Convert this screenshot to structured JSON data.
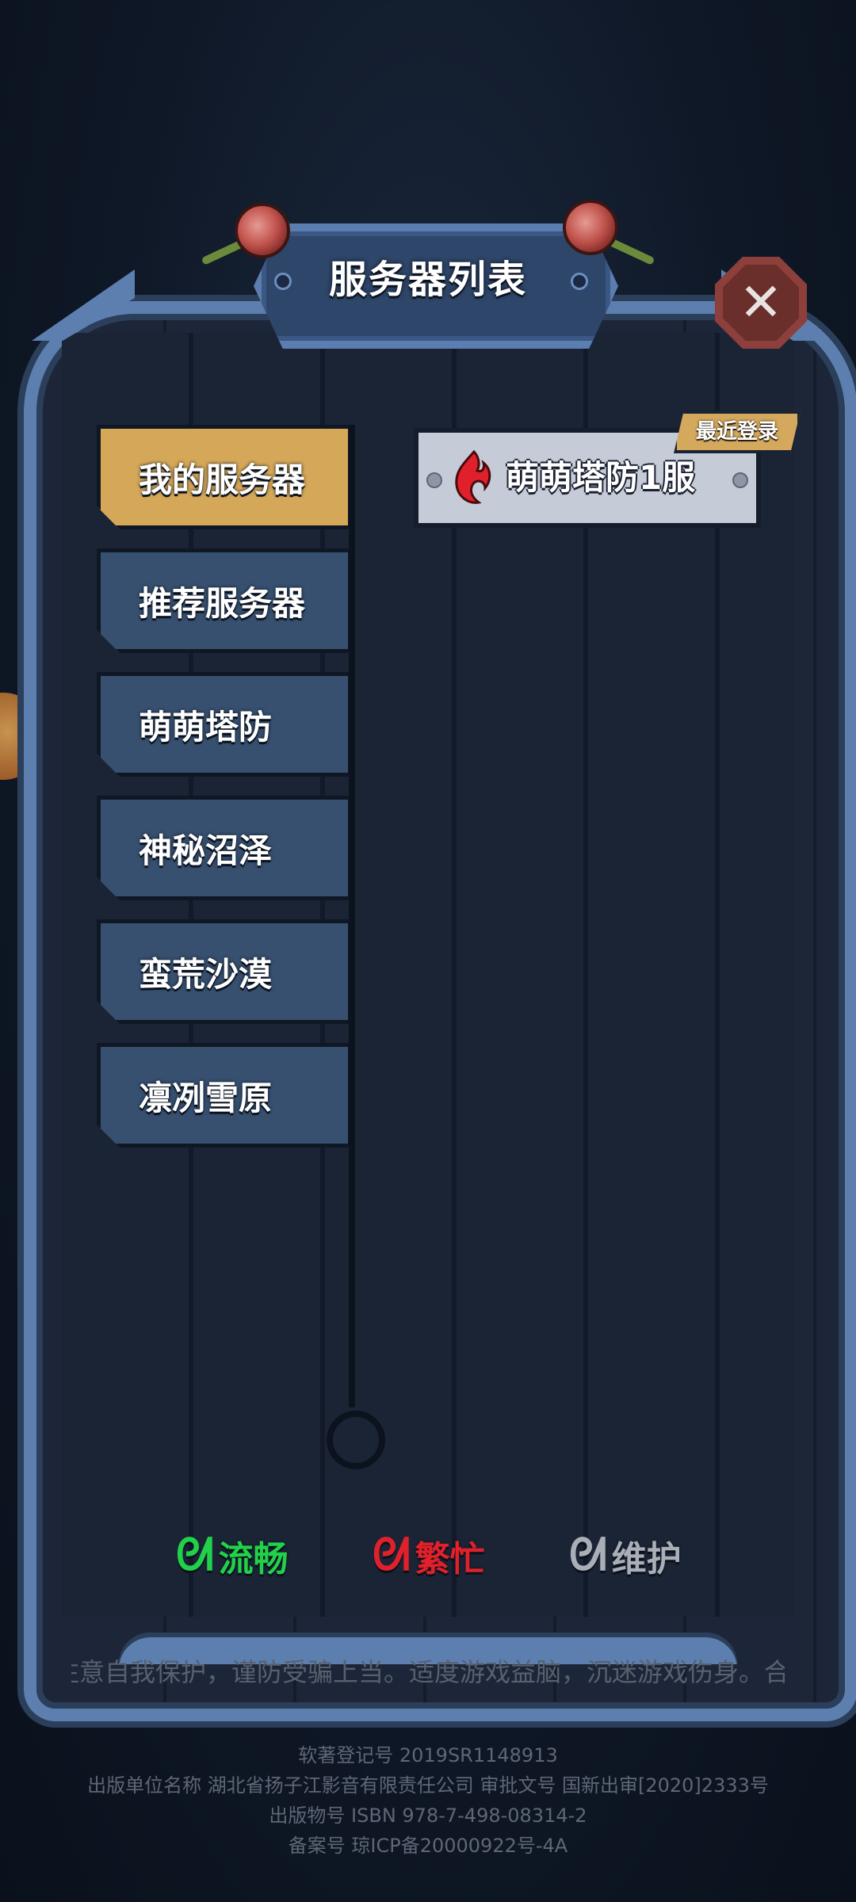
{
  "dialog": {
    "title": "服务器列表",
    "close_icon": "close-icon"
  },
  "menu": {
    "items": [
      {
        "label": "我的服务器",
        "active": true
      },
      {
        "label": "推荐服务器",
        "active": false
      },
      {
        "label": "萌萌塔防",
        "active": false
      },
      {
        "label": "神秘沼泽",
        "active": false
      },
      {
        "label": "蛮荒沙漠",
        "active": false
      },
      {
        "label": "凛冽雪原",
        "active": false
      }
    ]
  },
  "servers": {
    "recent_badge": "最近登录",
    "items": [
      {
        "name": "萌萌塔防1服",
        "status": "busy",
        "status_icon": "flame-status-icon"
      }
    ]
  },
  "legend": {
    "smooth": {
      "label": "流畅",
      "color": "#22d14a"
    },
    "busy": {
      "label": "繁忙",
      "color": "#e0212b"
    },
    "maintenance": {
      "label": "维护",
      "color": "#a9aeb7"
    }
  },
  "notice": {
    "health_text": "抵制不良游戏，拒绝盗版游戏。注意自我保护，谨防受骗上当。适度游戏益脑，沉迷游戏伤身。合理安排时间，享受健康生活。"
  },
  "footer": {
    "line1": "软著登记号 2019SR1148913",
    "line2": "出版单位名称 湖北省扬子江影音有限责任公司 审批文号 国新出审[2020]2333号",
    "line3": "出版物号 ISBN 978-7-498-08314-2",
    "line4": "备案号 琼ICP备20000922号-4A"
  }
}
